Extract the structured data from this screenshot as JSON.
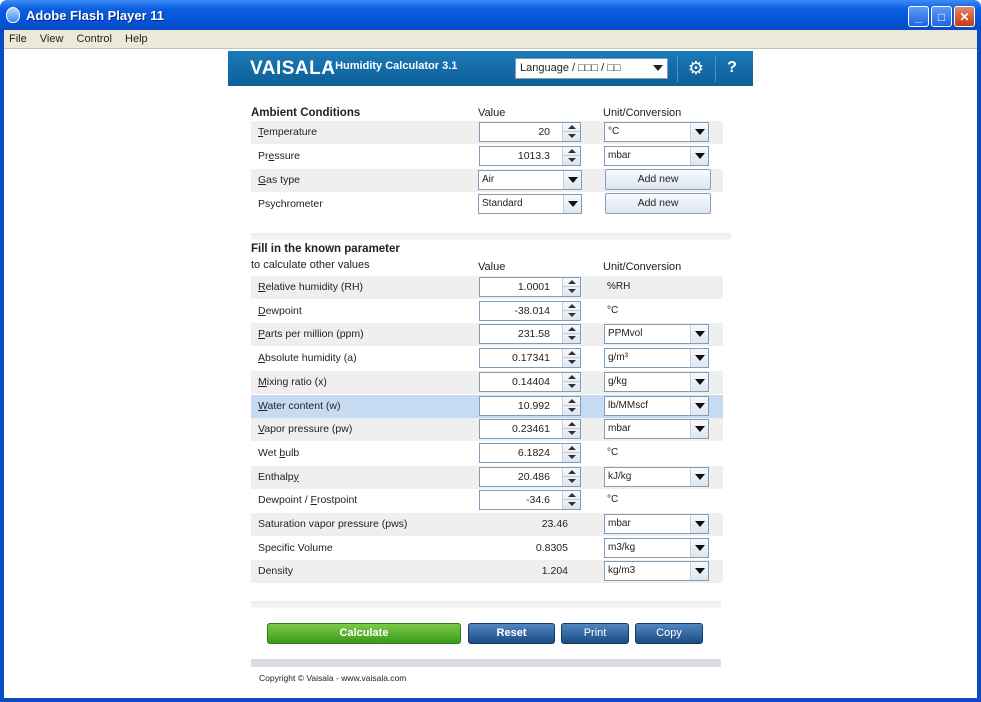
{
  "window": {
    "title": "Adobe Flash Player 11",
    "min_label": "_",
    "max_label": "□",
    "close_label": "✕"
  },
  "menu": [
    "File",
    "View",
    "Control",
    "Help"
  ],
  "header": {
    "logo": "VAISALA",
    "product": "/ Humidity Calculator 3.1",
    "language": "Language / □□□ / □□",
    "gear_glyph": "⚙",
    "help_glyph": "?"
  },
  "ambient": {
    "title": "Ambient Conditions",
    "value_header": "Value",
    "unit_header": "Unit/Conversion",
    "rows": [
      {
        "label_pre": "",
        "label_u": "T",
        "label_post": "emperature",
        "value": "20",
        "unit": "°C"
      },
      {
        "label_pre": "Pr",
        "label_u": "e",
        "label_post": "ssure",
        "value": "1013.3",
        "unit": "mbar"
      },
      {
        "label_pre": "",
        "label_u": "G",
        "label_post": "as type",
        "select": "Air",
        "button": "Add new"
      },
      {
        "label_pre": "Psychrometer",
        "label_u": "",
        "label_post": "",
        "select": "Standard",
        "button": "Add new"
      }
    ]
  },
  "known": {
    "title": "Fill in the known parameter",
    "subtitle": "to calculate other values",
    "value_header": "Value",
    "unit_header": "Unit/Conversion",
    "rows": [
      {
        "label_pre": "",
        "label_u": "R",
        "label_post": "elative humidity (RH)",
        "value": "1.0001",
        "unit_text": "%RH"
      },
      {
        "label_pre": "",
        "label_u": "D",
        "label_post": "ewpoint",
        "value": "-38.014",
        "unit_text": "°C"
      },
      {
        "label_pre": "",
        "label_u": "P",
        "label_post": "arts per million (ppm)",
        "value": "231.58",
        "unit": "PPMvol"
      },
      {
        "label_pre": "",
        "label_u": "A",
        "label_post": "bsolute humidity (a)",
        "value": "0.17341",
        "unit": "g/m³"
      },
      {
        "label_pre": "",
        "label_u": "M",
        "label_post": "ixing ratio (x)",
        "value": "0.14404",
        "unit": "g/kg"
      },
      {
        "label_pre": "",
        "label_u": "W",
        "label_post": "ater content (w)",
        "value": "10.992",
        "unit": "lb/MMscf"
      },
      {
        "label_pre": "",
        "label_u": "V",
        "label_post": "apor pressure (pw)",
        "value": "0.23461",
        "unit": "mbar"
      },
      {
        "label_pre": "Wet ",
        "label_u": "b",
        "label_post": "ulb",
        "value": "6.1824",
        "unit_text": "°C"
      },
      {
        "label_pre": "Enthalp",
        "label_u": "y",
        "label_post": "",
        "value": "20.486",
        "unit": "kJ/kg"
      },
      {
        "label_pre": "Dewpoint / ",
        "label_u": "F",
        "label_post": "rostpoint",
        "value": "-34.6",
        "unit_text": "°C"
      },
      {
        "label_pre": "Saturation vapor pressure (pws)",
        "label_u": "",
        "label_post": "",
        "plain": "23.46",
        "unit": "mbar"
      },
      {
        "label_pre": "Specific Volume",
        "label_u": "",
        "label_post": "",
        "plain": "0.8305",
        "unit": "m3/kg"
      },
      {
        "label_pre": "Density",
        "label_u": "",
        "label_post": "",
        "plain": "1.204",
        "unit": "kg/m3"
      }
    ]
  },
  "buttons": {
    "calculate": "Calculate",
    "reset": "Reset",
    "print": "Print",
    "copy": "Copy"
  },
  "copyright": "Copyright © Vaisala - www.vaisala.com"
}
